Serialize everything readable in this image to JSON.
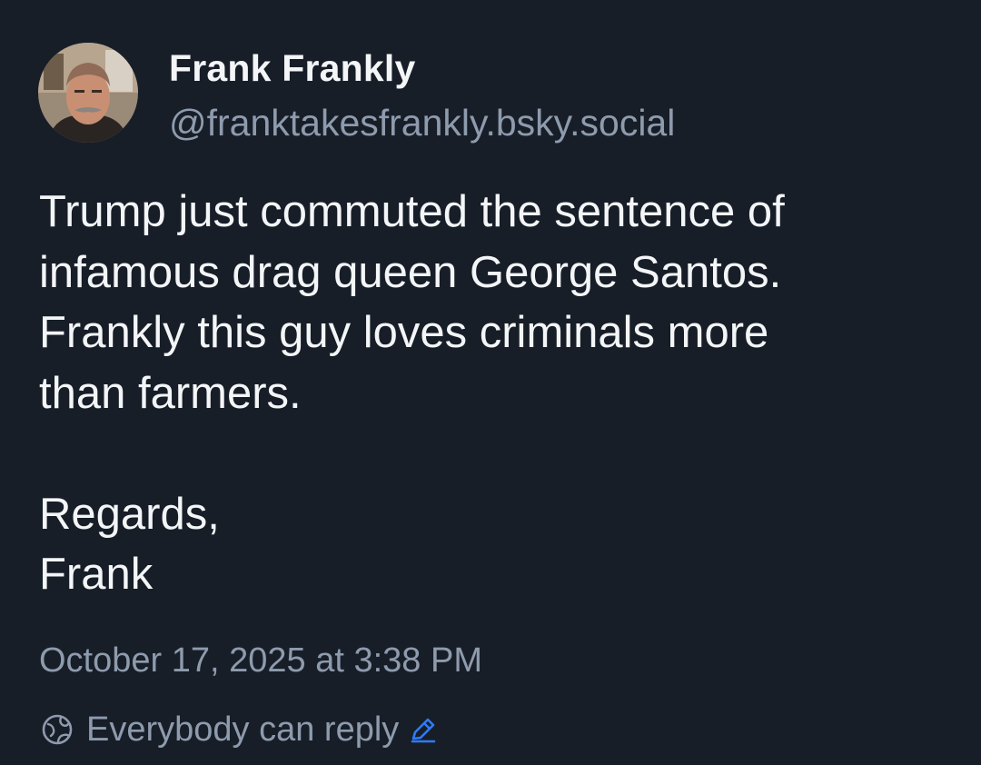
{
  "author": {
    "display_name": "Frank Frankly",
    "handle": "@franktakesfrankly.bsky.social",
    "avatar": "avatar-photo"
  },
  "post": {
    "text": "Trump just commuted the sentence of\ninfamous drag queen George Santos.\nFrankly this guy loves criminals more\nthan farmers.\n\nRegards,\nFrank",
    "timestamp": "October 17, 2025 at 3:38 PM"
  },
  "reply_setting": {
    "label": "Everybody can reply",
    "icon": "globe-icon",
    "edit_icon": "pencil-icon"
  },
  "colors": {
    "background": "#171e28",
    "text_primary": "#f3f5f7",
    "text_secondary": "#8e9bad",
    "accent": "#2f7bf5"
  }
}
